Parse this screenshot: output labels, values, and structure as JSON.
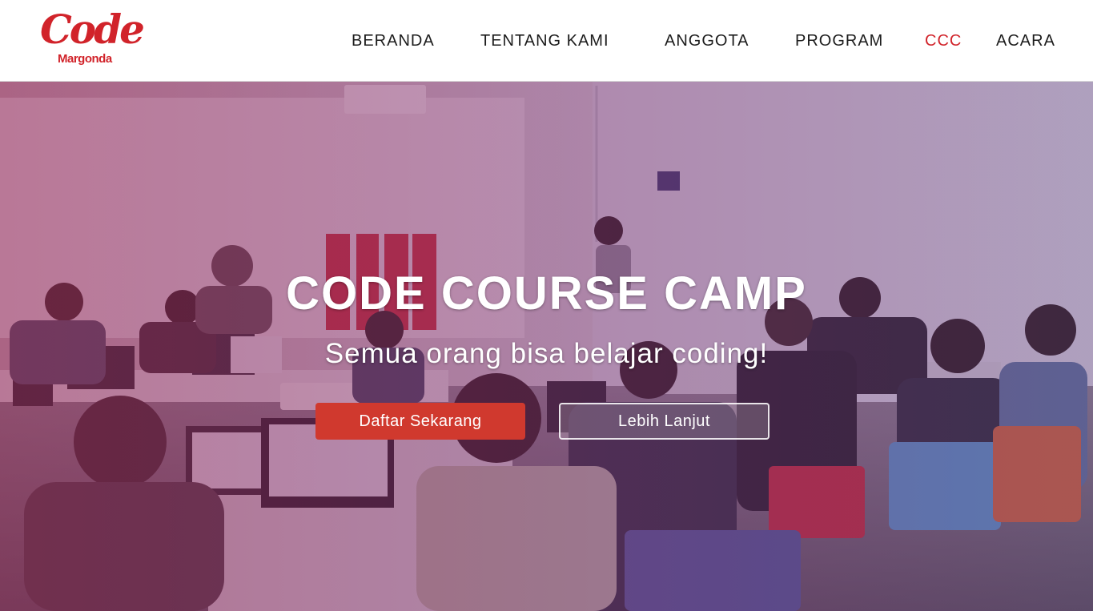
{
  "logo": {
    "main": "Code",
    "sub": "Margonda"
  },
  "nav": {
    "items": [
      {
        "label": "BERANDA"
      },
      {
        "label": "TENTANG KAMI"
      },
      {
        "label": "ANGGOTA"
      },
      {
        "label": "PROGRAM"
      },
      {
        "label": "CCC",
        "active": true
      },
      {
        "label": "ACARA"
      }
    ]
  },
  "hero": {
    "title": "CODE COURSE CAMP",
    "subtitle": "Semua orang bisa belajar coding!",
    "primary_button": "Daftar Sekarang",
    "secondary_button": "Lebih Lanjut",
    "photo_icon": "classroom-photo"
  },
  "colors": {
    "brand_red": "#d1232a",
    "button_red": "#d0392e",
    "overlay": "#922054",
    "nav_text": "#1c1c1c"
  }
}
